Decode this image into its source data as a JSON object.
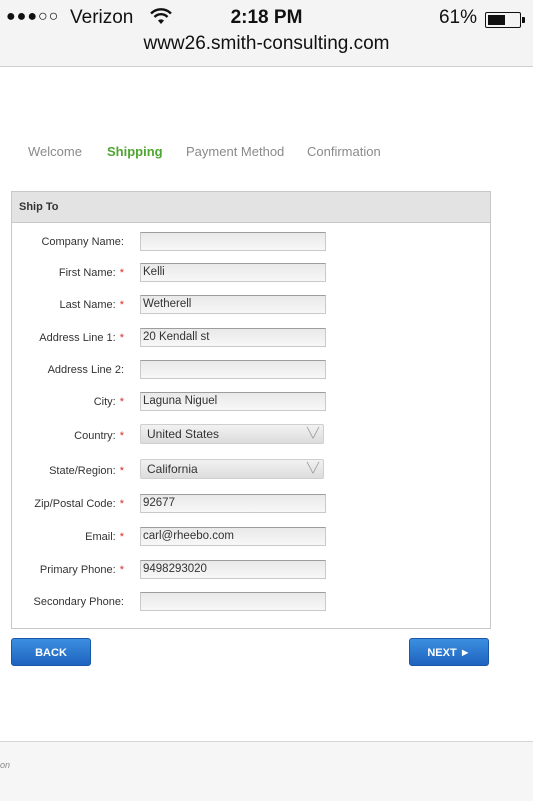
{
  "status_bar": {
    "signal": "●●●○○",
    "carrier": "Verizon",
    "time": "2:18 PM",
    "battery_pct": "61%",
    "battery_level": 0.61
  },
  "address_bar": {
    "url": "www26.smith-consulting.com"
  },
  "steps": [
    "Welcome",
    "Shipping",
    "Payment Method",
    "Confirmation"
  ],
  "active_step": "Shipping",
  "panel": {
    "title": "Ship To"
  },
  "form": {
    "company_label": "Company Name:",
    "company_value": "",
    "first_label": "First Name:",
    "first_value": "Kelli",
    "last_label": "Last Name:",
    "last_value": "Wetherell",
    "addr1_label": "Address Line 1:",
    "addr1_value": "20 Kendall st",
    "addr2_label": "Address Line 2:",
    "addr2_value": "",
    "city_label": "City:",
    "city_value": "Laguna Niguel",
    "country_label": "Country:",
    "country_value": "United States",
    "state_label": "State/Region:",
    "state_value": "California",
    "zip_label": "Zip/Postal Code:",
    "zip_value": "92677",
    "email_label": "Email:",
    "email_value": "carl@rheebo.com",
    "phone1_label": "Primary Phone:",
    "phone1_value": "9498293020",
    "phone2_label": "Secondary Phone:",
    "phone2_value": "",
    "required_mark": "*"
  },
  "buttons": {
    "back": "BACK",
    "next": "NEXT ►"
  },
  "footer": {
    "text": "on"
  },
  "colors": {
    "accent_green": "#4ea531",
    "button_blue": "#2f7fd6",
    "required_red": "#d62b2b"
  }
}
